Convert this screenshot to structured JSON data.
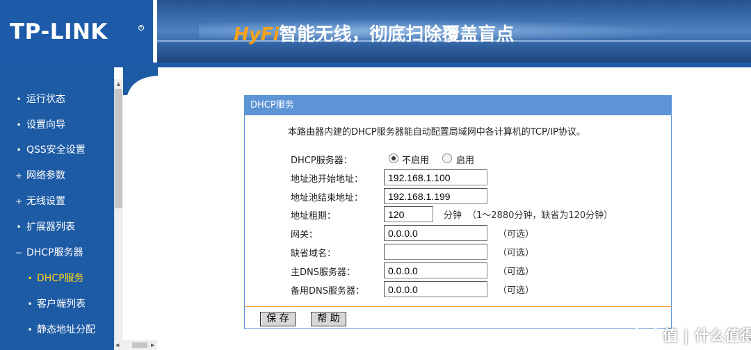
{
  "header": {
    "logo": "TP-LINK",
    "slogan_brand": "HyFi",
    "slogan_text": "智能无线，彻底扫除覆盖盲点"
  },
  "sidebar": {
    "items": [
      {
        "label": "运行状态",
        "bullet": "•"
      },
      {
        "label": "设置向导",
        "bullet": "•"
      },
      {
        "label": "QSS安全设置",
        "bullet": "•"
      },
      {
        "label": "网络参数",
        "bullet": "+"
      },
      {
        "label": "无线设置",
        "bullet": "+"
      },
      {
        "label": "扩展器列表",
        "bullet": "•"
      },
      {
        "label": "DHCP服务器",
        "bullet": "−"
      },
      {
        "label": "DHCP服务",
        "bullet": "•",
        "active": true
      },
      {
        "label": "客户端列表",
        "bullet": "•"
      },
      {
        "label": "静态地址分配",
        "bullet": "•"
      }
    ]
  },
  "panel": {
    "title": "DHCP服务",
    "description": "本路由器内建的DHCP服务器能自动配置局域网中各计算机的TCP/IP协议。",
    "dhcp_server": {
      "label": "DHCP服务器：",
      "option_off": "不启用",
      "option_on": "启用",
      "selected": "不启用"
    },
    "fields": {
      "pool_start": {
        "label": "地址池开始地址：",
        "value": "192.168.1.100"
      },
      "pool_end": {
        "label": "地址池结束地址：",
        "value": "192.168.1.199"
      },
      "lease": {
        "label": "地址租期：",
        "value": "120",
        "unit": "分钟",
        "hint": "（1～2880分钟，缺省为120分钟）"
      },
      "gateway": {
        "label": "网关：",
        "value": "0.0.0.0",
        "hint": "（可选）"
      },
      "domain": {
        "label": "缺省域名：",
        "value": "",
        "hint": "（可选）"
      },
      "dns_primary": {
        "label": "主DNS服务器：",
        "value": "0.0.0.0",
        "hint": "（可选）"
      },
      "dns_secondary": {
        "label": "备用DNS服务器：",
        "value": "0.0.0.0",
        "hint": "（可选）"
      }
    },
    "buttons": {
      "save": "保 存",
      "help": "帮 助"
    }
  },
  "watermark": {
    "text": "值 | 什么值得买"
  },
  "colors": {
    "brand_blue": "#1d5aa8",
    "panel_blue": "#5d94d6",
    "accent_orange": "#f29d3c",
    "active_yellow": "#ffd21e"
  }
}
